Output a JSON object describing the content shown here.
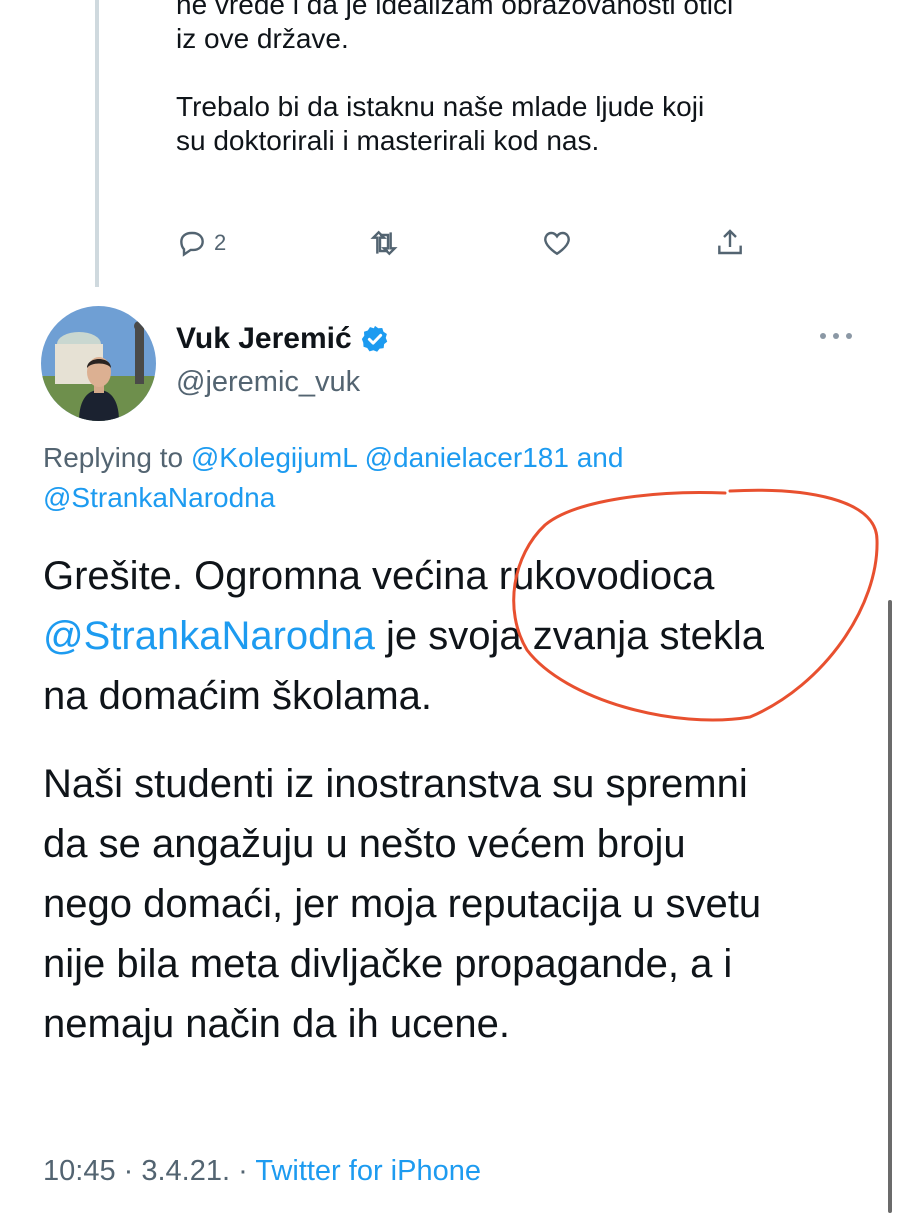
{
  "parent_tweet": {
    "lines_paragraph_1": [
      "ne vrede i da je idealizam obrazovanosti otići",
      "iz ove države."
    ],
    "lines_paragraph_2": [
      "Trebalo bi da istaknu naše mlade ljude koji",
      "su doktorirali i masterirali kod nas."
    ],
    "reply_count": "2"
  },
  "icons": {
    "reply": "reply-bubble-icon",
    "retweet": "retweet-icon",
    "like": "heart-icon",
    "share": "share-icon",
    "verified": "verified-badge-icon",
    "more": "more-options-icon"
  },
  "tweet": {
    "author_name": "Vuk Jeremić",
    "author_handle": "@jeremic_vuk",
    "replying_prefix": "Replying to",
    "replying_to_1": "@KolegijumL",
    "replying_to_2": "@danielacer181",
    "replying_and": "and",
    "replying_to_3": "@StrankaNarodna",
    "p1_a": "Grešite. Ogromna većina rukovodioca",
    "p1_mention": "@StrankaNarodna",
    "p1_b": " je svoja zvanja stekla",
    "p1_c": "na domaćim školama.",
    "p2": [
      "Naši studenti iz inostranstva su spremni",
      "da se angažuju u nešto većem broju",
      "nego domaći, jer moja reputacija u svetu",
      "nije bila meta divljačke propagande, a i",
      "nemaju način da ih ucene."
    ],
    "time": "10:45",
    "date": "3.4.21.",
    "source": "Twitter for iPhone"
  },
  "colors": {
    "link": "#1d9bf0",
    "verified": "#1d9bf0",
    "annotation": "#e8502f",
    "muted": "#536471"
  }
}
